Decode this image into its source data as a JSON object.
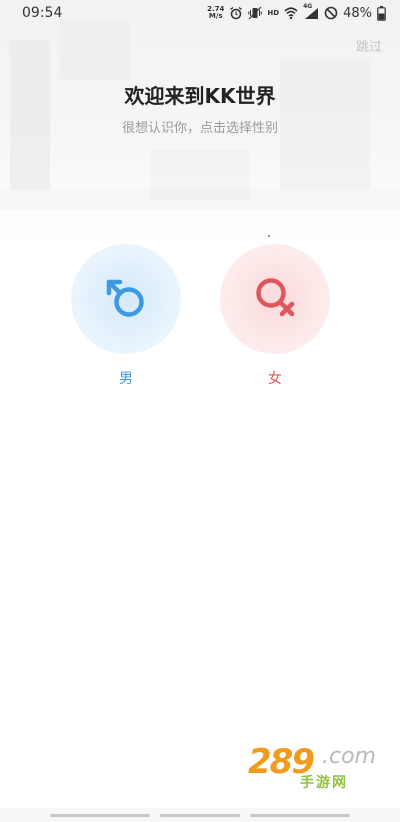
{
  "status_bar": {
    "time": "09:54",
    "net_speed_value": "2.74",
    "net_speed_unit": "M/s",
    "hd_label": "HD",
    "signal_label": "4G",
    "battery_percent": "48%"
  },
  "header": {
    "skip_label": "跳过",
    "title": "欢迎来到KK世界",
    "subtitle": "很想认识你，点击选择性别"
  },
  "gender_options": [
    {
      "id": "male",
      "label": "男",
      "icon": "male-symbol-icon",
      "color": "#3d9ae0"
    },
    {
      "id": "female",
      "label": "女",
      "icon": "female-symbol-icon",
      "color": "#e0565c"
    }
  ],
  "watermark": {
    "number": "289",
    "domain": ".com",
    "text": "手游网"
  },
  "colors": {
    "male_accent": "#3d9ae0",
    "female_accent": "#e0565c",
    "title_text": "#222222",
    "subtitle_text": "#9a9a9a"
  }
}
